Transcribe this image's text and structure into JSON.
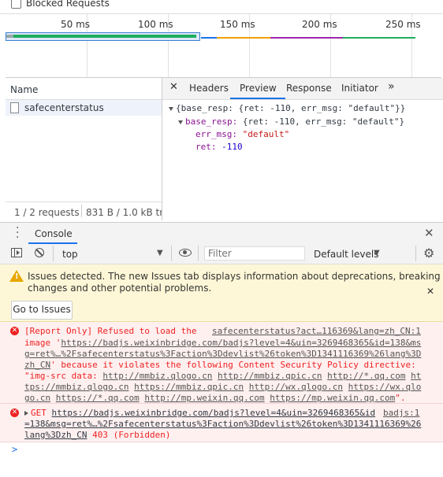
{
  "top": {
    "blocked_requests_label": "Blocked Requests"
  },
  "timeline": {
    "ticks": [
      "50 ms",
      "100 ms",
      "150 ms",
      "200 ms",
      "250 ms"
    ]
  },
  "network": {
    "name_header": "Name",
    "request_name": "safecenterstatus",
    "status_requests": "1 / 2 requests",
    "status_size": "831 B / 1.0 kB trar"
  },
  "detail": {
    "tabs": [
      "Headers",
      "Preview",
      "Response",
      "Initiator"
    ],
    "active_tab": "Preview",
    "preview": {
      "line1": "{base_resp: {ret: -110, err_msg: \"default\"}}",
      "line2_key": "base_resp:",
      "line2_val": " {ret: -110, err_msg: \"default\"}",
      "line3_key": "err_msg:",
      "line3_val": " \"default\"",
      "line4_key": "ret:",
      "line4_val": " -110"
    }
  },
  "console": {
    "tab_label": "Console",
    "context": "top",
    "filter_placeholder": "Filter",
    "levels": "Default levels",
    "issues": {
      "line1": "Issues detected. The new Issues tab displays information about deprecations, breaking",
      "line2": "changes and other potential problems.",
      "button": "Go to Issues"
    },
    "error1": {
      "source": "safecenterstatus?act…116369&lang=zh_CN:1",
      "l1": "[Report Only] Refused to load the",
      "l2a": "image '",
      "l2b": "https://badjs.weixinbridge.com/badjs?level=4&uin=3269468365&id=138&ms",
      "l3": "g=ret%…%2Fsafecenterstatus%3Faction%3Ddevlist%26token%3D1341116369%26lang%3D",
      "l4a": "zh_CN",
      "l4b": "' because it violates the following Content Security Policy directive:",
      "l5a": "\"img-src data: ",
      "l5b": "http://mmbiz.qlogo.cn",
      "l5c": "http://mmbiz.qpic.cn",
      "l5d": "http://*.qq.com",
      "l5e": "ht",
      "l6a": "tps://mmbiz.qlogo.cn",
      "l6b": "https://mmbiz.qpic.cn",
      "l6c": "http://wx.qlogo.cn",
      "l6d": "https://wx.qlo",
      "l7a": "go.cn",
      "l7b": "https://*.qq.com",
      "l7c": "http://mp.weixin.qq.com",
      "l7d": "https://mp.weixin.qq.com",
      "l7e": "\"."
    },
    "error2": {
      "method": "GET",
      "url": "https://badjs.weixinbridge.com/badjs?level=4&uin=3269468365&id",
      "source": "badjs:1",
      "l2": "=138&msg=ret%…%2Fsafecenterstatus%3Faction%3Ddevlist%26token%3D1341116369%26",
      "l3a": "lang%3Dzh_CN",
      "l3b": " 403 (Forbidden)"
    },
    "prompt": ">"
  }
}
